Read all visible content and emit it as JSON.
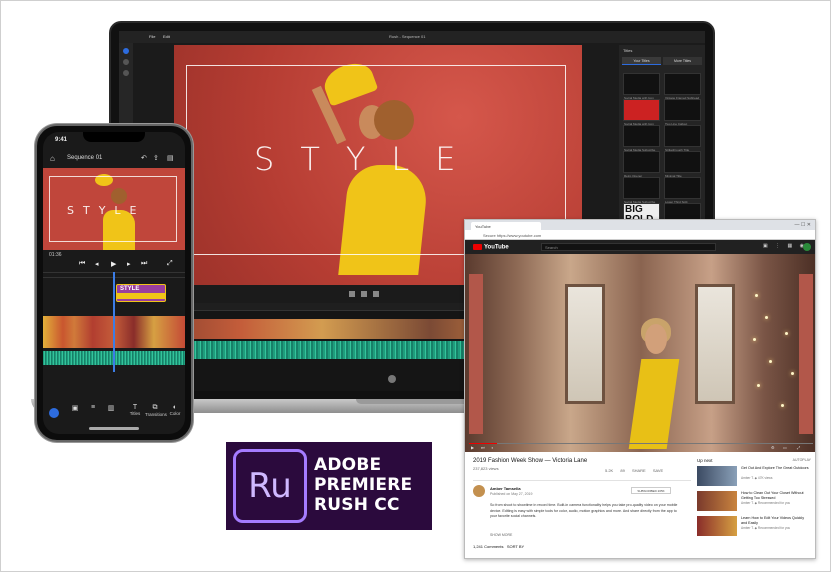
{
  "laptop": {
    "sequence_title": "Rush - Sequence 01",
    "menu": [
      "File",
      "Edit"
    ],
    "viewer_text": "STYLE",
    "panel": {
      "header": "Titles",
      "tabs": [
        "Your Titles",
        "More Titles"
      ],
      "thumbs": [
        {
          "caption": "Social Media with Icon",
          "style": "dark"
        },
        {
          "caption": "Vintage Framed Subhead",
          "style": "dark"
        },
        {
          "caption": "Social Media with Icon",
          "style": "red"
        },
        {
          "caption": "Two Line Callout",
          "style": "dark"
        },
        {
          "caption": "Social Media Subscribe",
          "style": "dark"
        },
        {
          "caption": "Strikethrough Title",
          "style": "dark"
        },
        {
          "caption": "Retro Opener",
          "style": "dark"
        },
        {
          "caption": "Minimal Title",
          "style": "dark"
        },
        {
          "caption": "Social Media Subscribe",
          "style": "dark"
        },
        {
          "caption": "Lower Third Split",
          "style": "dark"
        },
        {
          "caption": "",
          "style": "big",
          "text": "BIG BOLD"
        },
        {
          "caption": "",
          "style": "dark"
        }
      ]
    }
  },
  "phone": {
    "clock": "9:41",
    "sequence_title": "Sequence 01",
    "viewer_text": "STYLE",
    "timecode": "01:36",
    "title_clip_label": "STYLE",
    "tools": [
      "Titles",
      "Transitions",
      "Color"
    ]
  },
  "logo": {
    "mark": "Ru",
    "lines": [
      "ADOBE",
      "PREMIERE",
      "RUSH CC"
    ],
    "bg": "#2b0a3d",
    "accent": "#a57cff"
  },
  "browser": {
    "tab_title": "YouTube",
    "url": "Secure  https://www.youtube.com",
    "youtube": {
      "logo": "YouTube",
      "search_placeholder": "Search",
      "video_title": "2019 Fashion Week Show — Victoria Lane",
      "views": "237,823 views",
      "actions": [
        "5.2K",
        "89",
        "SHARE",
        "SAVE"
      ],
      "channel_name": "Amber Tamsella",
      "channel_date": "Published on May 27, 2019",
      "subscribe_label": "SUBSCRIBED 205K",
      "description": "So from shoot to showtime in record time. Built-in camera functionality helps you take pro-quality video on your mobile device. Editing is easy with simple tools for color, audio, motion graphics and more. And share directly from the app to your favorite social channels.",
      "show_more": "SHOW MORE",
      "comments": "1,241 Comments",
      "sort_label": "SORT BY",
      "up_next_label": "Up next",
      "autoplay_label": "AUTOPLAY",
      "up_next": [
        {
          "title": "Get Out And Explore The Great Outdoors",
          "meta": "Amber T. ◆ 47K views"
        },
        {
          "title": "How to Clean Out Your Closet Without Getting Too Stressed",
          "meta": "Amber T. ◆ Recommended for you"
        },
        {
          "title": "Learn How to Edit Your Videos Quickly and Easily",
          "meta": "Amber T. ◆ Recommended for you"
        }
      ]
    }
  }
}
